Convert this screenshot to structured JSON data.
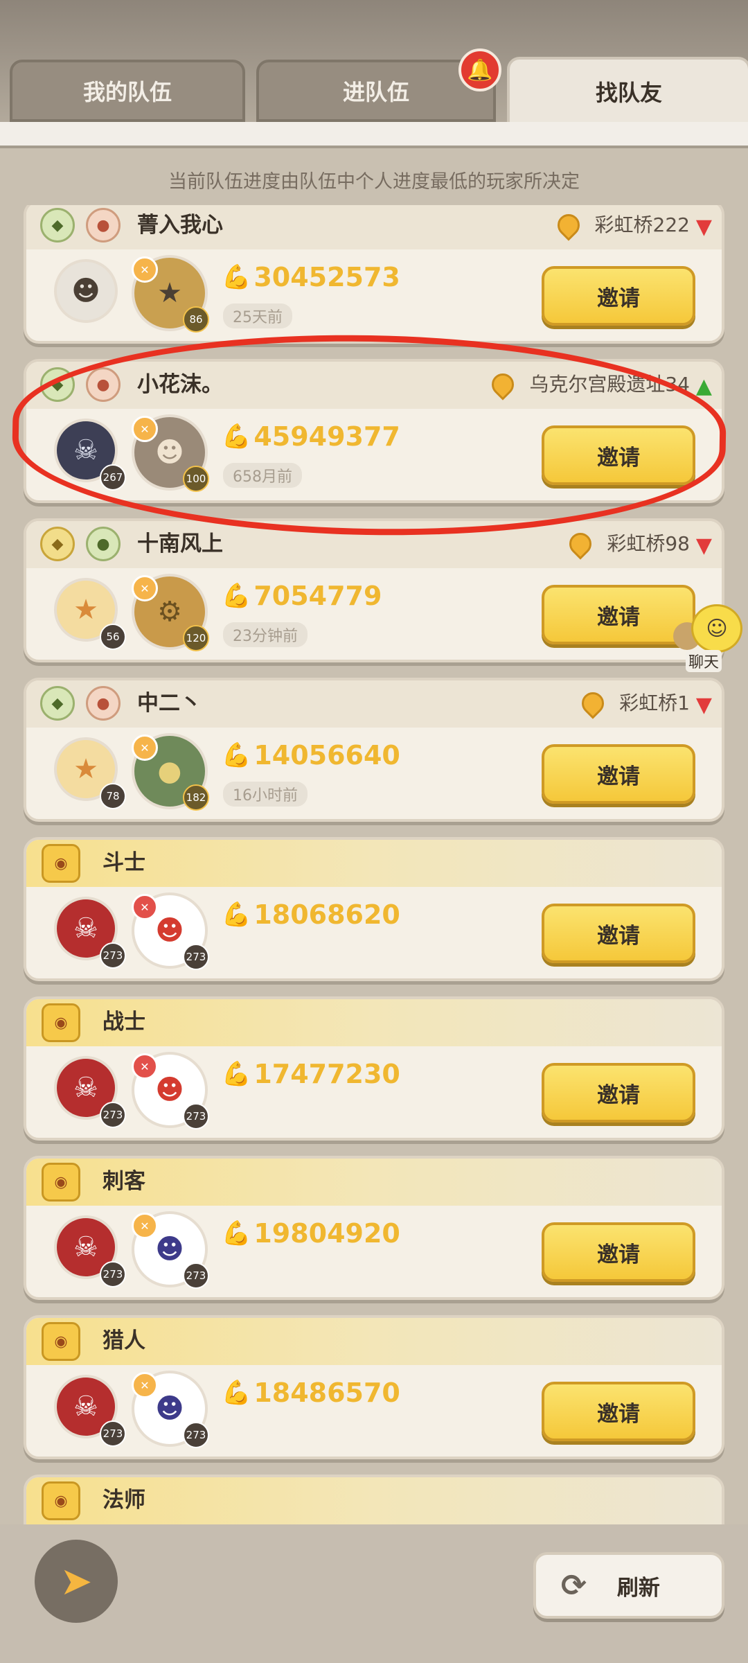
{
  "tabs": [
    "我的队伍",
    "进队伍",
    "找队友"
  ],
  "active_tab": 2,
  "notice": "当前队伍进度由队伍中个人进度最低的玩家所决定",
  "players": [
    {
      "name": "菁入我心",
      "location": "彩虹桥222",
      "level1": "86",
      "power": "30452573",
      "time": "25天前"
    },
    {
      "name": "小花沫。",
      "location": "乌克尔宫殿遗址34",
      "level1": "267",
      "level2": "100",
      "power": "45949377",
      "time": "658月前"
    },
    {
      "name": "十南风上",
      "location": "彩虹桥98",
      "level1": "56",
      "level2": "120",
      "power": "7054779",
      "time": "23分钟前"
    },
    {
      "name": "中二丶",
      "location": "彩虹桥1",
      "level1": "78",
      "level2": "182",
      "power": "14056640",
      "time": "16小时前"
    }
  ],
  "jobs": [
    {
      "name": "斗士",
      "level1": "273",
      "level2": "273",
      "power": "18068620"
    },
    {
      "name": "战士",
      "level1": "273",
      "level2": "273",
      "power": "17477230"
    },
    {
      "name": "刺客",
      "level1": "273",
      "level2": "273",
      "power": "19804920"
    },
    {
      "name": "猎人",
      "level1": "273",
      "level2": "273",
      "power": "18486570"
    },
    {
      "name": "法师"
    }
  ],
  "invite_label": "邀请",
  "chat_label": "聊天",
  "refresh_label": "刷新",
  "colors": {
    "accent_yellow": "#f5c83a",
    "power_text": "#f0b730",
    "highlight_circle": "#e83121"
  }
}
